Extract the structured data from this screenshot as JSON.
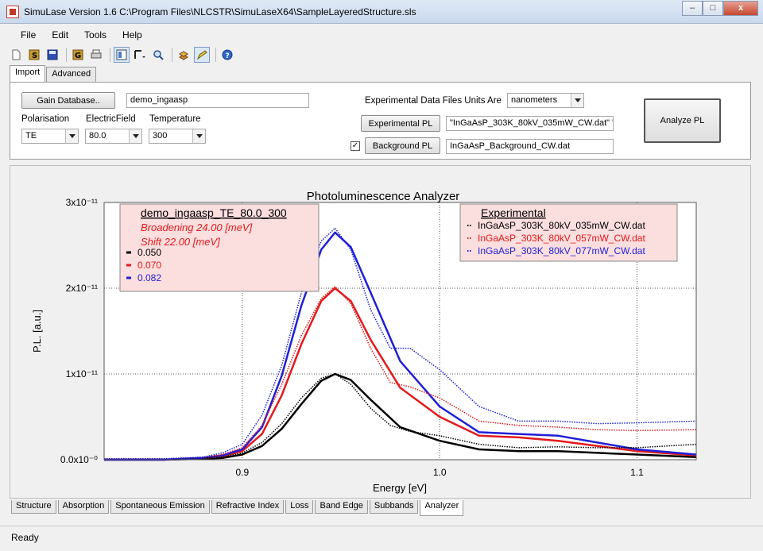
{
  "window": {
    "title": "SimuLase Version 1.6    C:\\Program Files\\NLCSTR\\SimuLaseX64\\SampleLayeredStructure.sls",
    "controls": [
      "–",
      "□",
      "x"
    ]
  },
  "menu": [
    "File",
    "Edit",
    "Tools",
    "Help"
  ],
  "toolbar": {
    "icons": [
      "new-file-icon",
      "save-s-icon",
      "save-disk-icon",
      "gain-g-icon",
      "print-icon",
      "layout-icon",
      "ruler-dropdown-icon",
      "magnifier-icon",
      "layers-icon",
      "pencil-icon",
      "help-icon"
    ]
  },
  "top_tabs": [
    "Import",
    "Advanced"
  ],
  "import_panel": {
    "gain_db_button": "Gain Database..",
    "gain_db_value": "demo_ingaasp",
    "polarisation_label": "Polarisation",
    "polarisation_value": "TE",
    "electricfield_label": "ElectricField",
    "electricfield_value": "80.0",
    "temperature_label": "Temperature",
    "temperature_value": "300",
    "units_label": "Experimental Data Files Units Are",
    "units_value": "nanometers",
    "exp_pl_button": "Experimental PL",
    "exp_pl_value": "\"InGaAsP_303K_80kV_035mW_CW.dat\" \"",
    "background_checked": "✓",
    "background_button": "Background PL",
    "background_value": "InGaAsP_Background_CW.dat",
    "analyze_button": "Analyze PL"
  },
  "chart_data": {
    "type": "line",
    "title": "Photoluminescence Analyzer",
    "xlabel": "Energy [eV]",
    "ylabel": "P.L. [a.u.]",
    "xlim": [
      0.83,
      1.13
    ],
    "ylim": [
      0,
      3e-11
    ],
    "x_ticks": [
      "0.9",
      "1.0",
      "1.1"
    ],
    "y_ticks": [
      "0.0x10⁻⁰",
      "1x10⁻¹¹",
      "2x10⁻¹¹",
      "3x10⁻¹¹"
    ],
    "grid": true,
    "theory_legend": {
      "heading": "demo_ingaasp_TE_80.0_300",
      "broadening": "Broadening 24.00 [meV]",
      "shift": "Shift 22.00 [meV]",
      "entries": [
        {
          "label": "0.050",
          "color": "#000000"
        },
        {
          "label": "0.070",
          "color": "#e31a1c"
        },
        {
          "label": "0.082",
          "color": "#1f1fd6"
        }
      ]
    },
    "experimental_legend": {
      "heading": "Experimental",
      "entries": [
        {
          "label": "InGaAsP_303K_80kV_035mW_CW.dat",
          "color": "#000000"
        },
        {
          "label": "InGaAsP_303K_80kV_057mW_CW.dat",
          "color": "#e31a1c"
        },
        {
          "label": "InGaAsP_303K_80kV_077mW_CW.dat",
          "color": "#1f1fd6"
        }
      ]
    },
    "theory_x": [
      0.83,
      0.86,
      0.88,
      0.89,
      0.9,
      0.91,
      0.92,
      0.93,
      0.94,
      0.947,
      0.955,
      0.965,
      0.98,
      1.0,
      1.02,
      1.04,
      1.06,
      1.08,
      1.1,
      1.13
    ],
    "theory_series": [
      {
        "name": "0.050",
        "color": "#000000",
        "values": [
          0.0,
          0.0,
          1e-13,
          2e-13,
          6e-13,
          1.6e-12,
          3.6e-12,
          6.5e-12,
          9.2e-12,
          1e-11,
          9.3e-12,
          7e-12,
          3.8e-12,
          2.2e-12,
          1.2e-12,
          1e-12,
          1e-12,
          8e-13,
          6e-13,
          3e-13
        ]
      },
      {
        "name": "0.070",
        "color": "#e31a1c",
        "values": [
          0.0,
          0.0,
          2e-13,
          4e-13,
          1e-12,
          3e-12,
          7.5e-12,
          1.35e-11,
          1.85e-11,
          2e-11,
          1.85e-11,
          1.4e-11,
          8.4e-12,
          5e-12,
          2.8e-12,
          2.6e-12,
          2.2e-12,
          1.6e-12,
          1e-12,
          5e-13
        ]
      },
      {
        "name": "0.082",
        "color": "#1f1fd6",
        "values": [
          0.0,
          0.0,
          2e-13,
          5e-13,
          1.2e-12,
          3.8e-12,
          9.8e-12,
          1.8e-11,
          2.45e-11,
          2.65e-11,
          2.48e-11,
          1.95e-11,
          1.15e-11,
          6.2e-12,
          3.2e-12,
          3e-12,
          2.8e-12,
          2e-12,
          1.2e-12,
          6e-13
        ]
      }
    ],
    "exp_x": [
      0.83,
      0.86,
      0.88,
      0.89,
      0.9,
      0.91,
      0.92,
      0.93,
      0.94,
      0.947,
      0.955,
      0.965,
      0.975,
      0.985,
      1.0,
      1.02,
      1.04,
      1.06,
      1.08,
      1.1,
      1.13
    ],
    "exp_series": [
      {
        "name": "InGaAsP_303K_80kV_035mW_CW.dat",
        "color": "#000000",
        "values": [
          1e-13,
          1e-13,
          2e-13,
          3e-13,
          8e-13,
          2e-12,
          4.2e-12,
          7.2e-12,
          9.5e-12,
          1e-11,
          8.8e-12,
          6e-12,
          4e-12,
          3.3e-12,
          2.8e-12,
          1.8e-12,
          1.4e-12,
          1.5e-12,
          1.4e-12,
          1.4e-12,
          1.8e-12
        ]
      },
      {
        "name": "InGaAsP_303K_80kV_057mW_CW.dat",
        "color": "#e31a1c",
        "values": [
          1e-13,
          1e-13,
          3e-13,
          6e-13,
          1.4e-12,
          4e-12,
          8.8e-12,
          1.45e-11,
          1.88e-11,
          2.02e-11,
          1.82e-11,
          1.3e-11,
          9e-12,
          8.5e-12,
          7.2e-12,
          4.5e-12,
          4e-12,
          3.8e-12,
          3.5e-12,
          3.4e-12,
          3.5e-12
        ]
      },
      {
        "name": "InGaAsP_303K_80kV_077mW_CW.dat",
        "color": "#1f1fd6",
        "values": [
          1e-13,
          1e-13,
          3e-13,
          8e-13,
          1.8e-12,
          5.2e-12,
          1.1e-11,
          1.95e-11,
          2.55e-11,
          2.7e-11,
          2.45e-11,
          1.75e-11,
          1.3e-11,
          1.3e-11,
          1.05e-11,
          6.2e-12,
          4.5e-12,
          4.5e-12,
          4.2e-12,
          4.3e-12,
          4.5e-12
        ]
      }
    ]
  },
  "bottom_tabs": [
    "Structure",
    "Absorption",
    "Spontaneous Emission",
    "Refractive Index",
    "Loss",
    "Band Edge",
    "Subbands",
    "Analyzer"
  ],
  "status": "Ready"
}
